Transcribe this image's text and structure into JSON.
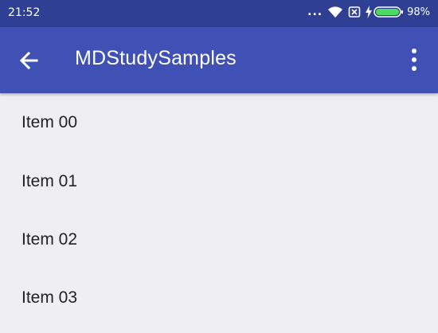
{
  "status_bar": {
    "time": "21:52",
    "signal_dots": "...",
    "battery_percent": "98%",
    "colors": {
      "background": "#2f3f93",
      "battery_fill": "#4cd964"
    }
  },
  "app_bar": {
    "title": "MDStudySamples",
    "back_icon": "arrow-back-icon",
    "overflow_icon": "more-vert-icon",
    "color": "#3f51b5"
  },
  "list": {
    "items": [
      {
        "label": "Item 00"
      },
      {
        "label": "Item 01"
      },
      {
        "label": "Item 02"
      },
      {
        "label": "Item 03"
      }
    ]
  }
}
